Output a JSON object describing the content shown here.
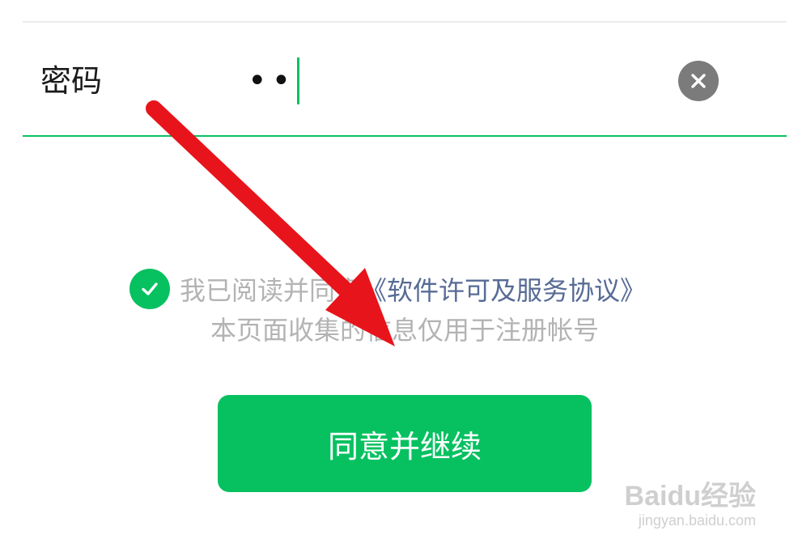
{
  "form": {
    "password_label": "密码",
    "password_value": "••"
  },
  "agreement": {
    "checked": true,
    "prefix_text": "我已阅读并同意",
    "link_text": "《软件许可及服务协议》",
    "notice_text": "本页面收集的信息仅用于注册帐号"
  },
  "actions": {
    "continue_label": "同意并继续"
  },
  "watermark": {
    "brand": "Baidu经验",
    "url": "jingyan.baidu.com"
  },
  "icons": {
    "clear": "close-icon",
    "check": "checkmark-icon",
    "annotation": "red-arrow-icon"
  },
  "colors": {
    "accent": "#07c160",
    "link": "#576b95",
    "muted_text": "#b3b3b3",
    "clear_button": "#7b7b7b",
    "annotation_arrow": "#e8141b"
  }
}
